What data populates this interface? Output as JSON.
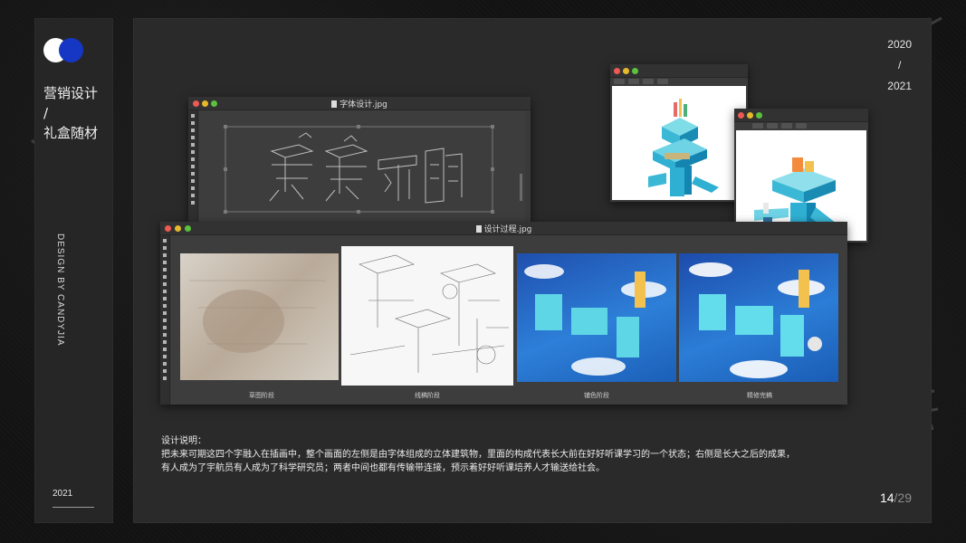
{
  "sidebar": {
    "title_line1": "营销设计",
    "title_sep": "/",
    "title_line2": "礼盒随材",
    "vertical_text": "DESIGN BY CANDYJIA",
    "year": "2021"
  },
  "header": {
    "year_start": "2020",
    "year_sep": "/",
    "year_end": "2021"
  },
  "windows": {
    "font_design": {
      "title": "字体设计.jpg"
    },
    "process": {
      "title": "设计过程.jpg",
      "stages": [
        "草图阶段",
        "线稿阶段",
        "铺色阶段",
        "精修完稿"
      ]
    }
  },
  "description": {
    "heading": "设计说明：",
    "line1": "把未来可期这四个字融入在插画中，整个画面的左侧是由字体组成的立体建筑物，里面的构成代表长大前在好好听课学习的一个状态；右侧是长大之后的成果，",
    "line2": "有人成为了宇航员有人成为了科学研究员；两者中间也都有传输带连接，预示着好好听课培养人才输送给社会。"
  },
  "pagination": {
    "current": "14",
    "total": "/29"
  },
  "colors": {
    "accent_blue": "#1637c4",
    "panel": "#2a2a2a",
    "sidebar": "#262626"
  }
}
